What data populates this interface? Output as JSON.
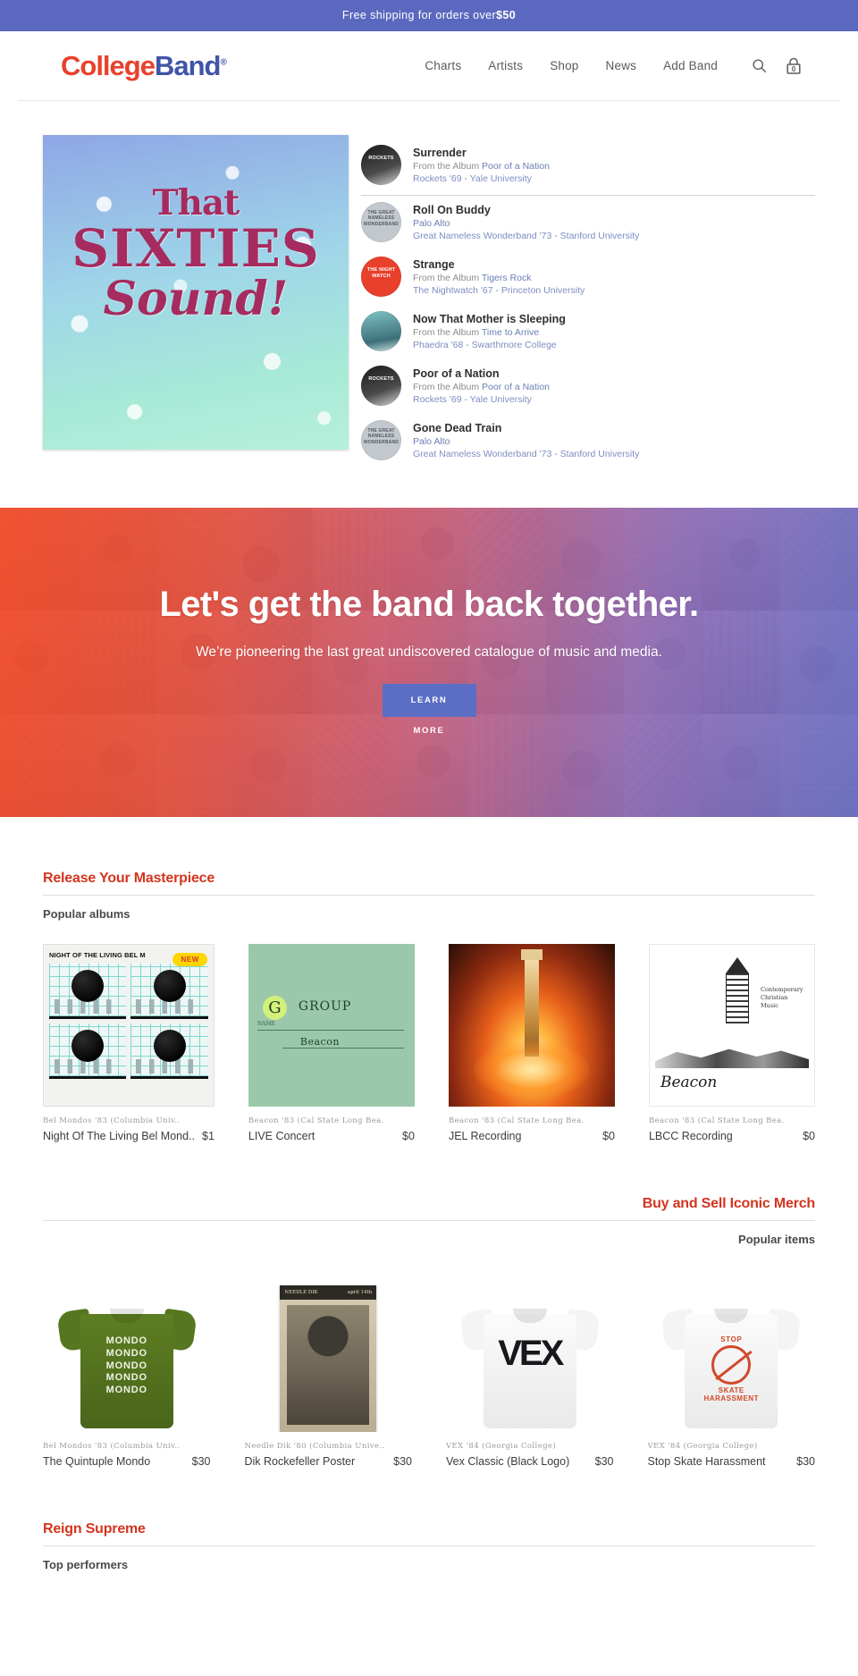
{
  "announcement": {
    "text": "Free shipping for orders over",
    "amount": "$50"
  },
  "header": {
    "logo": {
      "part1": "College",
      "part2": "Band",
      "mark": "®"
    },
    "nav": [
      {
        "label": "Charts"
      },
      {
        "label": "Artists"
      },
      {
        "label": "Shop"
      },
      {
        "label": "News"
      },
      {
        "label": "Add Band"
      }
    ],
    "search_icon": "search-icon",
    "cart_icon": "cart-icon",
    "cart_count": "0"
  },
  "featured": {
    "album_art": {
      "line1": "That",
      "line2": "SIXTIES",
      "line3": "Sound!"
    },
    "tracks": [
      {
        "title": "Surrender",
        "album_prefix": "From the Album",
        "album": "Poor of a Nation",
        "band": "Rockets '69 - Yale University",
        "thumb_label": "ROCKETS",
        "thumb_style": "rockets"
      },
      {
        "title": "Roll On Buddy",
        "album_prefix": "",
        "album": "Palo Alto",
        "band": "Great Nameless Wonderband '73 - Stanford University",
        "thumb_label": "THE GREAT NAMELESS WONDERBAND",
        "thumb_style": "wonder"
      },
      {
        "title": "Strange",
        "album_prefix": "From the Album",
        "album": "Tigers Rock",
        "band": "The Nightwatch '67 - Princeton University",
        "thumb_label": "THE NIGHT WATCH",
        "thumb_style": "night"
      },
      {
        "title": "Now That Mother is Sleeping",
        "album_prefix": "From the Album",
        "album": "Time to Arrive",
        "band": "Phaedra '68 - Swarthmore College",
        "thumb_label": "",
        "thumb_style": "phaedra"
      },
      {
        "title": "Poor of a Nation",
        "album_prefix": "From the Album",
        "album": "Poor of a Nation",
        "band": "Rockets '69 - Yale University",
        "thumb_label": "ROCKETS",
        "thumb_style": "rockets"
      },
      {
        "title": "Gone Dead Train",
        "album_prefix": "",
        "album": "Palo Alto",
        "band": "Great Nameless Wonderband '73 - Stanford University",
        "thumb_label": "THE GREAT NAMELESS WONDERBAND",
        "thumb_style": "wonder"
      }
    ]
  },
  "hero": {
    "headline": "Let's get the band back together.",
    "subhead": "We’re pioneering the last great undiscovered catalogue of music and media.",
    "cta_label": "LEARN",
    "cta_label2": "MORE"
  },
  "albums_section": {
    "heading": "Release Your Masterpiece",
    "subheading": "Popular albums",
    "items": [
      {
        "band": "Bel Mondos '83 (Columbia Univ..",
        "name": "Night Of The Living Bel Mond..",
        "price": "$1",
        "badge": "NEW",
        "cover": "night-of-the-living",
        "cover_title": "NIGHT OF THE LIVING BEL M"
      },
      {
        "band": "Beacon '83 (Cal State Long Bea.",
        "name": "LIVE Concert",
        "price": "$0",
        "badge": "",
        "cover": "group-beacon",
        "cover_title": "GROUP",
        "cover_name_label": "NAME",
        "cover_sub": "Beacon"
      },
      {
        "band": "Beacon '83 (Cal State Long Bea.",
        "name": "JEL Recording",
        "price": "$0",
        "badge": "",
        "cover": "jel-tower",
        "cover_title": ""
      },
      {
        "band": "Beacon '83 (Cal State Long Bea.",
        "name": "LBCC Recording",
        "price": "$0",
        "badge": "",
        "cover": "beacon-lighthouse",
        "cover_title": "Beacon",
        "cover_sub": "Contemporary Christian Music"
      }
    ]
  },
  "merch_section": {
    "heading": "Buy and Sell Iconic Merch",
    "subheading": "Popular items",
    "items": [
      {
        "band": "Bel Mondos '83 (Columbia Univ..",
        "name": "The Quintuple Mondo",
        "price": "$30",
        "art": "tee-green-mondo",
        "art_lines": [
          "MONDO",
          "MONDO",
          "MONDO",
          "MONDO",
          "MONDO"
        ]
      },
      {
        "band": "Needle Dik '80 (Columbia Unive..",
        "name": "Dik Rockefeller Poster",
        "price": "$30",
        "art": "poster-needle-dik",
        "poster_top_left": "NEEDLE DIK",
        "poster_top_right": "april 14th"
      },
      {
        "band": "VEX '84 (Georgia College)",
        "name": "Vex Classic (Black Logo)",
        "price": "$30",
        "art": "tee-white-vex",
        "art_text": "VEX"
      },
      {
        "band": "VEX '84 (Georgia College)",
        "name": "Stop Skate Harassment",
        "price": "$30",
        "art": "tee-white-stop",
        "art_stop": "STOP",
        "art_sub1": "SKATE",
        "art_sub2": "HARASSMENT"
      }
    ]
  },
  "performers_section": {
    "heading": "Reign Supreme",
    "subheading": "Top performers"
  },
  "colors": {
    "announce_bg": "#5b68bf",
    "brand_red": "#e8412c",
    "brand_blue": "#4055a8",
    "section_heading": "#d3351f",
    "cta_bg": "#5b6ec4"
  }
}
